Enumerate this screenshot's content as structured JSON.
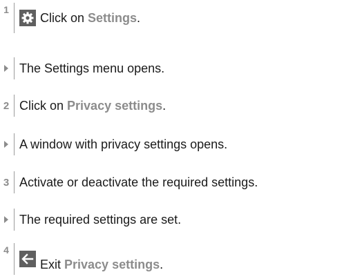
{
  "steps": [
    {
      "marker": "1",
      "icon": "gear-icon",
      "pre": "Click on ",
      "em": "Settings",
      "post": "."
    },
    {
      "marker": "result",
      "text": "The Settings menu opens."
    },
    {
      "marker": "2",
      "pre": "Click on ",
      "em": "Privacy settings",
      "post": "."
    },
    {
      "marker": "result",
      "text": "A window with privacy settings opens."
    },
    {
      "marker": "3",
      "text": "Activate or deactivate the required settings."
    },
    {
      "marker": "result",
      "text": "The required settings are set."
    },
    {
      "marker": "4",
      "icon": "arrow-left-icon",
      "pre": "Exit ",
      "em": "Privacy settings",
      "post": "."
    }
  ]
}
